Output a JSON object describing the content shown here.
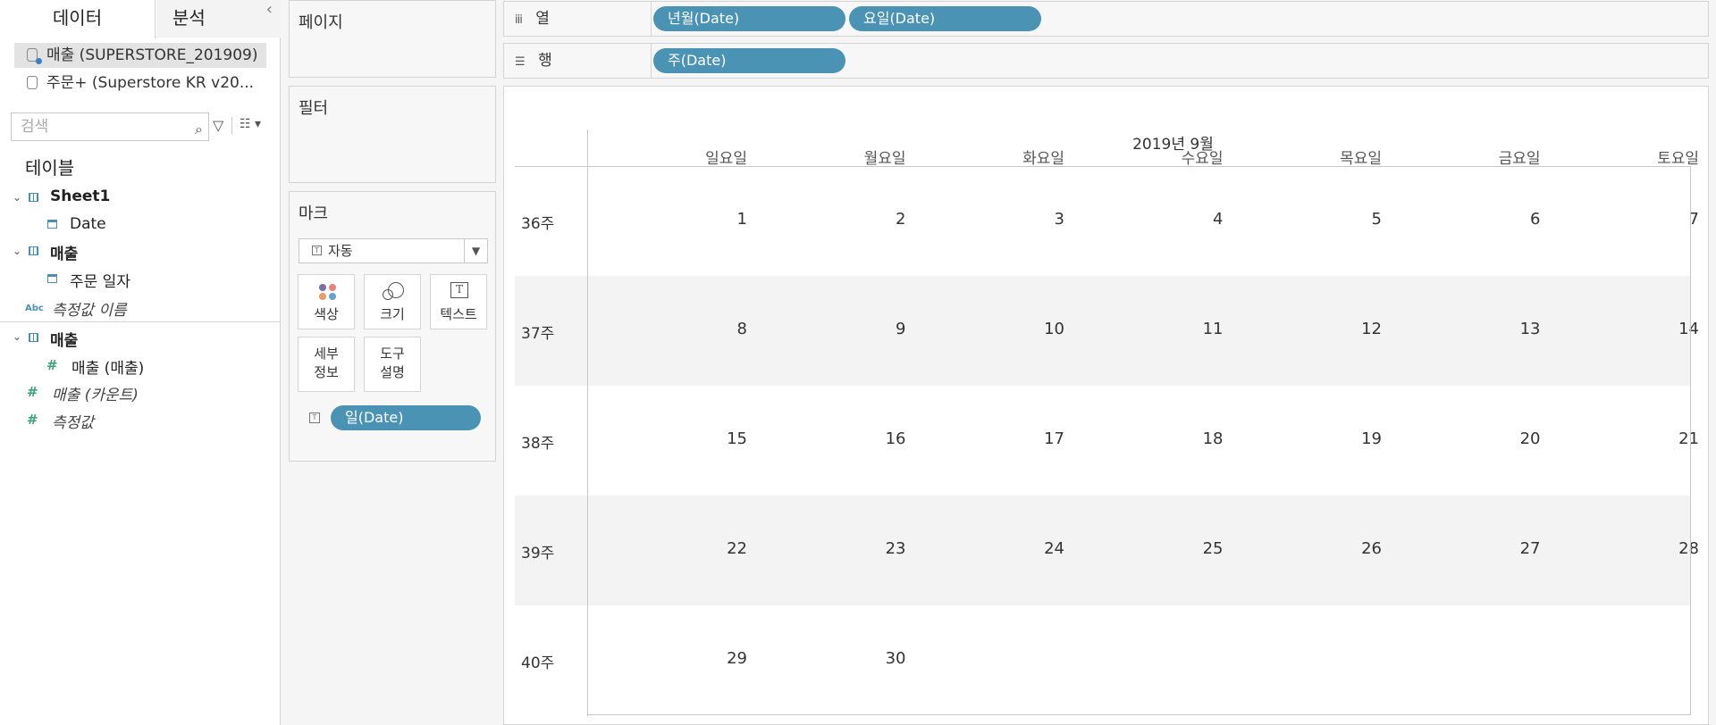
{
  "tabs": {
    "data": "데이터",
    "analysis": "분석",
    "collapse": "‹"
  },
  "datasources": [
    {
      "label": "매출 (SUPERSTORE_201909)"
    },
    {
      "label": "주문+ (Superstore KR v20..."
    }
  ],
  "search": {
    "placeholder": "검색"
  },
  "tables_title": "테이블",
  "fields": {
    "sheet1": "Sheet1",
    "date": "Date",
    "sales_table": "매출",
    "order_date": "주문 일자",
    "measure_names": "측정값 이름",
    "sales_table2": "매출",
    "sales_measure": "매출 (매출)",
    "sales_count": "매출 (카운트)",
    "measure_values": "측정값",
    "abc": "Abc"
  },
  "cards": {
    "pages": "페이지",
    "filters": "필터",
    "marks": "마크",
    "mark_type": "자동",
    "color": "색상",
    "size": "크기",
    "text": "텍스트",
    "detail": "세부\n정보",
    "detail_l1": "세부",
    "detail_l2": "정보",
    "tooltip_l1": "도구",
    "tooltip_l2": "설명",
    "mark_pill": "일(Date)"
  },
  "shelves": {
    "columns_label": "열",
    "columns_icon": "iii",
    "rows_label": "행",
    "rows_icon": "☰",
    "column_pills": [
      "년월(Date)",
      "요일(Date)"
    ],
    "row_pills": [
      "주(Date)"
    ]
  },
  "colors": {
    "pill": "#4a93b4",
    "band": "#f3f3f3"
  },
  "calendar": {
    "title": "2019년 9월",
    "days": [
      "일요일",
      "월요일",
      "화요일",
      "수요일",
      "목요일",
      "금요일",
      "토요일"
    ],
    "weeks": [
      {
        "label": "36주",
        "dates": [
          "1",
          "2",
          "3",
          "4",
          "5",
          "6",
          "7"
        ]
      },
      {
        "label": "37주",
        "dates": [
          "8",
          "9",
          "10",
          "11",
          "12",
          "13",
          "14"
        ]
      },
      {
        "label": "38주",
        "dates": [
          "15",
          "16",
          "17",
          "18",
          "19",
          "20",
          "21"
        ]
      },
      {
        "label": "39주",
        "dates": [
          "22",
          "23",
          "24",
          "25",
          "26",
          "27",
          "28"
        ]
      },
      {
        "label": "40주",
        "dates": [
          "29",
          "30",
          "",
          "",
          "",
          "",
          ""
        ]
      }
    ]
  }
}
